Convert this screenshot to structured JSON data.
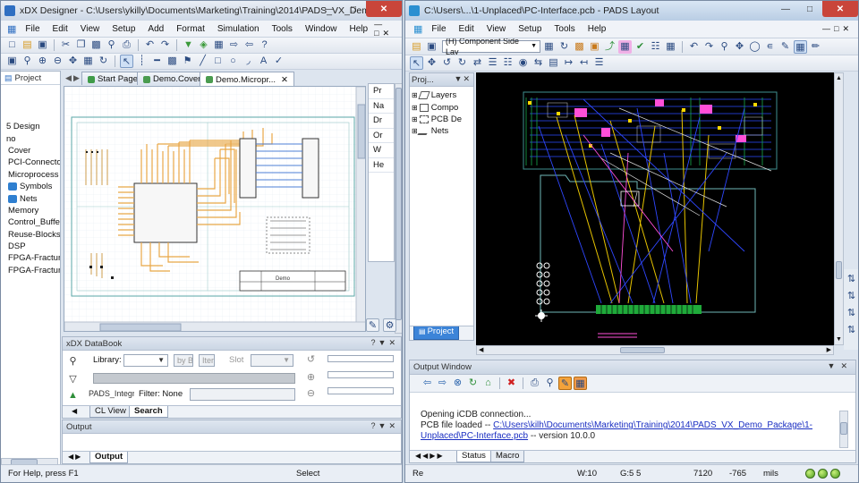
{
  "xdx": {
    "title": "xDX Designer - C:\\Users\\ykilly\\Documents\\Marketing\\Training\\2014\\PADS_VX_Demo...",
    "menu": [
      "File",
      "Edit",
      "View",
      "Setup",
      "Add",
      "Format",
      "Simulation",
      "Tools",
      "Window",
      "Help"
    ],
    "project_header": "Project",
    "tree": [
      "5 Design",
      "no",
      "Cover",
      "PCI-Connecto",
      "Microprocess",
      "Symbols",
      "Nets",
      "Memory",
      "Control_Buffe",
      "Reuse-Blocks",
      "DSP",
      "FPGA-Fractur",
      "FPGA-Fractur"
    ],
    "tabs": [
      "Start Page",
      "Demo.Cover",
      "Demo.Micropr..."
    ],
    "side_stubs": [
      "Pr",
      "Na",
      "Dr",
      "Or",
      "W",
      "He"
    ],
    "sheet_title": "Demo",
    "databook": {
      "header": "xDX DataBook",
      "library_label": "Library:",
      "by_label": "by Bu",
      "item_label": "Iter",
      "slot_label": "Slot",
      "part_field": "PADS_Integra",
      "filter_label": "Filter: None",
      "tab_clview": "CL View",
      "tab_search": "Search"
    },
    "output_header": "Output",
    "output_tab": "Output",
    "status_help": "For Help, press F1",
    "status_mode": "Select"
  },
  "pads": {
    "title": "C:\\Users\\...\\1-Unplaced\\PC-Interface.pcb - PADS Layout",
    "menu": [
      "File",
      "Edit",
      "View",
      "Setup",
      "Tools",
      "Help"
    ],
    "layer_select": "(H) Component Side Lay",
    "project_header": "Proj...",
    "tree": [
      "Layers",
      "Compo",
      "PCB De",
      "Nets"
    ],
    "project_tab": "Project",
    "output_header": "Output Window",
    "output_line1": "Opening iCDB connection...",
    "output_line2_prefix": "PCB file loaded -- ",
    "output_link1": "C:\\Users\\kilh\\Documents\\Marketing\\Training\\2014\\PADS_VX_Demo_Package\\1-",
    "output_link2": "Unplaced\\PC-Interface.pcb",
    "output_line3_suffix": " -- version 10.0.0",
    "bottom_tabs": [
      "Status",
      "Macro"
    ],
    "status": {
      "mode": "Re",
      "width": "W:10",
      "grid": "G:5 5",
      "x": "7120",
      "y": "-765",
      "units": "mils"
    }
  },
  "colors": {
    "xdx_icon": "#2f6fc2",
    "pads_icon": "#2a8fd1",
    "pcb_background": "#000000",
    "trace_yellow": "#ffd800",
    "trace_blue": "#3050ff",
    "trace_pink": "#ff4fd8",
    "schematic_orange": "#e8a646"
  }
}
